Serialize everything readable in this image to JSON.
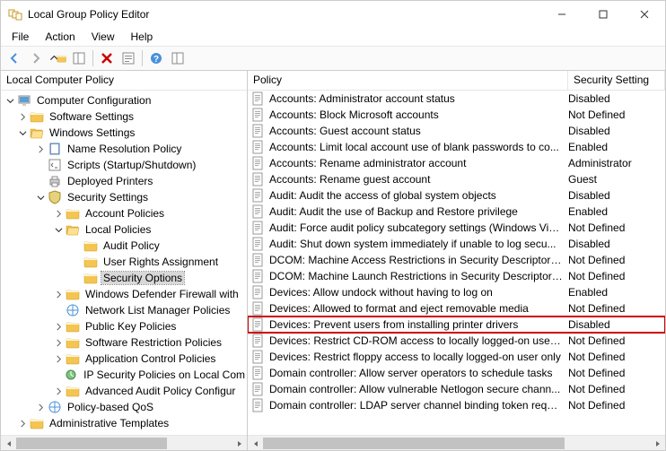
{
  "window": {
    "title": "Local Group Policy Editor"
  },
  "menu": {
    "file": "File",
    "action": "Action",
    "view": "View",
    "help": "Help"
  },
  "tree": {
    "header": "Local Computer Policy",
    "root": "Computer Configuration",
    "nodes": {
      "software": "Software Settings",
      "windows": "Windows Settings",
      "nrp": "Name Resolution Policy",
      "scripts": "Scripts (Startup/Shutdown)",
      "depprint": "Deployed Printers",
      "security": "Security Settings",
      "acctpol": "Account Policies",
      "localpol": "Local Policies",
      "auditpol": "Audit Policy",
      "ura": "User Rights Assignment",
      "secopt": "Security Options",
      "wdf": "Windows Defender Firewall with",
      "nlm": "Network List Manager Policies",
      "pkp": "Public Key Policies",
      "srp": "Software Restriction Policies",
      "acp": "Application Control Policies",
      "ipsec": "IP Security Policies on Local Com",
      "aapc": "Advanced Audit Policy Configur",
      "qos": "Policy-based QoS",
      "admtmpl": "Administrative Templates"
    }
  },
  "list": {
    "header": {
      "policy": "Policy",
      "setting": "Security Setting"
    },
    "rows": [
      {
        "policy": "Accounts: Administrator account status",
        "setting": "Disabled"
      },
      {
        "policy": "Accounts: Block Microsoft accounts",
        "setting": "Not Defined"
      },
      {
        "policy": "Accounts: Guest account status",
        "setting": "Disabled"
      },
      {
        "policy": "Accounts: Limit local account use of blank passwords to co...",
        "setting": "Enabled"
      },
      {
        "policy": "Accounts: Rename administrator account",
        "setting": "Administrator"
      },
      {
        "policy": "Accounts: Rename guest account",
        "setting": "Guest"
      },
      {
        "policy": "Audit: Audit the access of global system objects",
        "setting": "Disabled"
      },
      {
        "policy": "Audit: Audit the use of Backup and Restore privilege",
        "setting": "Enabled"
      },
      {
        "policy": "Audit: Force audit policy subcategory settings (Windows Vis...",
        "setting": "Not Defined"
      },
      {
        "policy": "Audit: Shut down system immediately if unable to log secu...",
        "setting": "Disabled"
      },
      {
        "policy": "DCOM: Machine Access Restrictions in Security Descriptor D...",
        "setting": "Not Defined"
      },
      {
        "policy": "DCOM: Machine Launch Restrictions in Security Descriptor ...",
        "setting": "Not Defined"
      },
      {
        "policy": "Devices: Allow undock without having to log on",
        "setting": "Enabled"
      },
      {
        "policy": "Devices: Allowed to format and eject removable media",
        "setting": "Not Defined"
      },
      {
        "policy": "Devices: Prevent users from installing printer drivers",
        "setting": "Disabled",
        "highlighted": true
      },
      {
        "policy": "Devices: Restrict CD-ROM access to locally logged-on user ...",
        "setting": "Not Defined"
      },
      {
        "policy": "Devices: Restrict floppy access to locally logged-on user only",
        "setting": "Not Defined"
      },
      {
        "policy": "Domain controller: Allow server operators to schedule tasks",
        "setting": "Not Defined"
      },
      {
        "policy": "Domain controller: Allow vulnerable Netlogon secure chann...",
        "setting": "Not Defined"
      },
      {
        "policy": "Domain controller: LDAP server channel binding token requi...",
        "setting": "Not Defined"
      }
    ]
  }
}
